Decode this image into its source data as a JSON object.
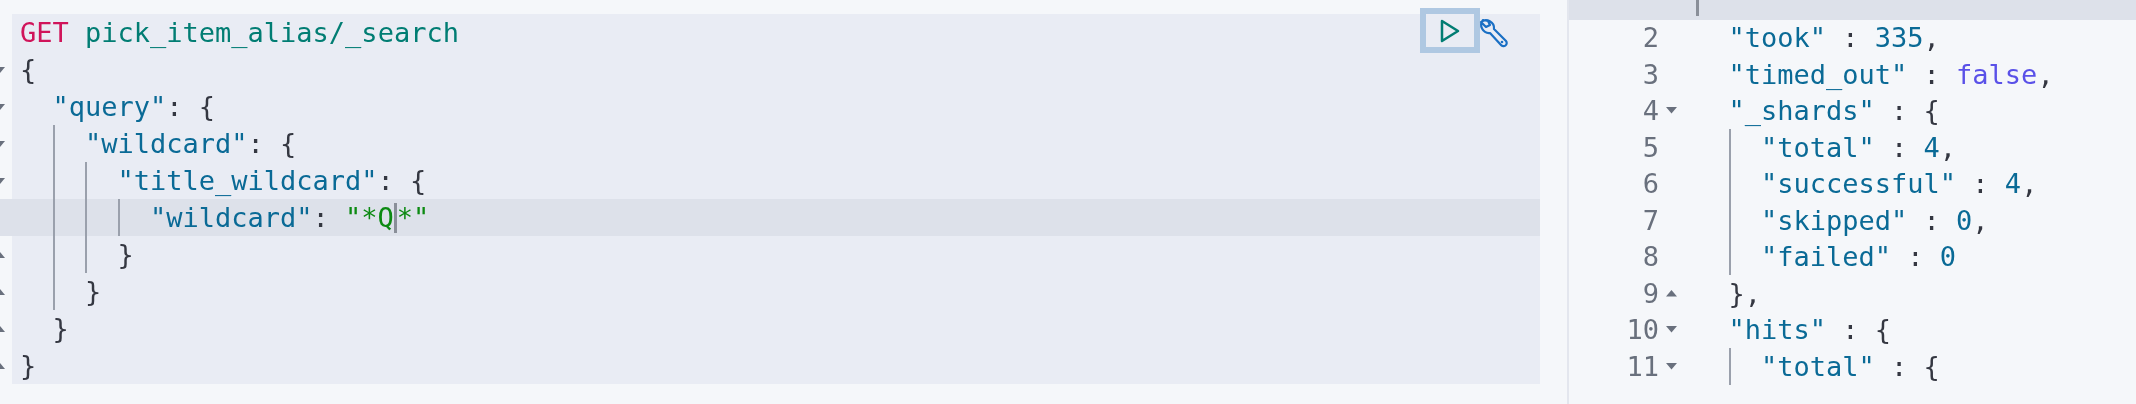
{
  "request": {
    "lines": [
      {
        "selected": false,
        "tokens": [
          {
            "kind": "method",
            "text": "GET"
          },
          {
            "kind": "path",
            "text": "pick_item_alias/_search"
          }
        ]
      },
      {
        "kind": "fold_start",
        "selected": false,
        "tokens": [
          {
            "kind": "punct",
            "text": "{"
          }
        ],
        "children": [
          {
            "kind": "fold_start",
            "selected": false,
            "tokens": [
              {
                "kind": "key",
                "text": "\"query\""
              },
              {
                "kind": "punct",
                "text": ": {"
              }
            ],
            "children": [
              {
                "kind": "fold_start",
                "selected": false,
                "tokens": [
                  {
                    "kind": "key",
                    "text": "\"wildcard\""
                  },
                  {
                    "kind": "punct",
                    "text": ": {"
                  }
                ],
                "children": [
                  {
                    "kind": "fold_start",
                    "selected": false,
                    "tokens": [
                      {
                        "kind": "key",
                        "text": "\"title_wildcard\""
                      },
                      {
                        "kind": "punct",
                        "text": ": {"
                      }
                    ],
                    "children": [
                      {
                        "selected": true,
                        "tokens": [
                          {
                            "kind": "key",
                            "text": "\"wildcard\""
                          },
                          {
                            "kind": "punct",
                            "text": ": "
                          },
                          {
                            "kind": "string",
                            "text": "\"*Q"
                          },
                          {
                            "kind": "cursor"
                          },
                          {
                            "kind": "string",
                            "text": "*\""
                          }
                        ]
                      }
                    ]
                  },
                  {
                    "kind": "fold_end",
                    "selected": false,
                    "tokens": [
                      {
                        "kind": "punct",
                        "text": "}"
                      }
                    ]
                  }
                ]
              },
              {
                "kind": "fold_end",
                "selected": false,
                "tokens": [
                  {
                    "kind": "punct",
                    "text": "}"
                  }
                ]
              }
            ]
          },
          {
            "kind": "fold_end",
            "selected": false,
            "tokens": [
              {
                "kind": "punct",
                "text": "}"
              }
            ]
          }
        ]
      },
      {
        "kind": "fold_end",
        "selected": false,
        "tokens": [
          {
            "kind": "punct",
            "text": "}"
          }
        ]
      }
    ]
  },
  "response": {
    "lines": [
      {
        "selected": true,
        "tokens": [
          {
            "kind": "cursor"
          }
        ],
        "children": [
          {
            "number": "2",
            "selected": false,
            "tokens": [
              {
                "kind": "key",
                "text": "\"took\""
              },
              {
                "kind": "punct",
                "text": " : "
              },
              {
                "kind": "number",
                "text": "335"
              },
              {
                "kind": "punct",
                "text": ","
              }
            ]
          },
          {
            "number": "3",
            "selected": false,
            "tokens": [
              {
                "kind": "key",
                "text": "\"timed_out\""
              },
              {
                "kind": "punct",
                "text": " : "
              },
              {
                "kind": "bool",
                "text": "false"
              },
              {
                "kind": "punct",
                "text": ","
              }
            ]
          },
          {
            "number": "4",
            "kind": "fold_start",
            "selected": false,
            "tokens": [
              {
                "kind": "key",
                "text": "\"_shards\""
              },
              {
                "kind": "punct",
                "text": " : {"
              }
            ],
            "children": [
              {
                "number": "5",
                "selected": false,
                "tokens": [
                  {
                    "kind": "key",
                    "text": "\"total\""
                  },
                  {
                    "kind": "punct",
                    "text": " : "
                  },
                  {
                    "kind": "number",
                    "text": "4"
                  },
                  {
                    "kind": "punct",
                    "text": ","
                  }
                ]
              },
              {
                "number": "6",
                "selected": false,
                "tokens": [
                  {
                    "kind": "key",
                    "text": "\"successful\""
                  },
                  {
                    "kind": "punct",
                    "text": " : "
                  },
                  {
                    "kind": "number",
                    "text": "4"
                  },
                  {
                    "kind": "punct",
                    "text": ","
                  }
                ]
              },
              {
                "number": "7",
                "selected": false,
                "tokens": [
                  {
                    "kind": "key",
                    "text": "\"skipped\""
                  },
                  {
                    "kind": "punct",
                    "text": " : "
                  },
                  {
                    "kind": "number",
                    "text": "0"
                  },
                  {
                    "kind": "punct",
                    "text": ","
                  }
                ]
              },
              {
                "number": "8",
                "selected": false,
                "tokens": [
                  {
                    "kind": "key",
                    "text": "\"failed\""
                  },
                  {
                    "kind": "punct",
                    "text": " : "
                  },
                  {
                    "kind": "number",
                    "text": "0"
                  }
                ]
              }
            ]
          },
          {
            "number": "9",
            "kind": "fold_end",
            "selected": false,
            "tokens": [
              {
                "kind": "punct",
                "text": "},"
              }
            ]
          },
          {
            "number": "10",
            "kind": "fold_start",
            "selected": false,
            "tokens": [
              {
                "kind": "key",
                "text": "\"hits\""
              },
              {
                "kind": "punct",
                "text": " : {"
              }
            ],
            "children": [
              {
                "number": "11",
                "kind": "fold_start",
                "selected": false,
                "tokens": [
                  {
                    "kind": "key",
                    "text": "\"total\""
                  },
                  {
                    "kind": "punct",
                    "text": " : {"
                  }
                ]
              }
            ]
          }
        ]
      }
    ]
  }
}
